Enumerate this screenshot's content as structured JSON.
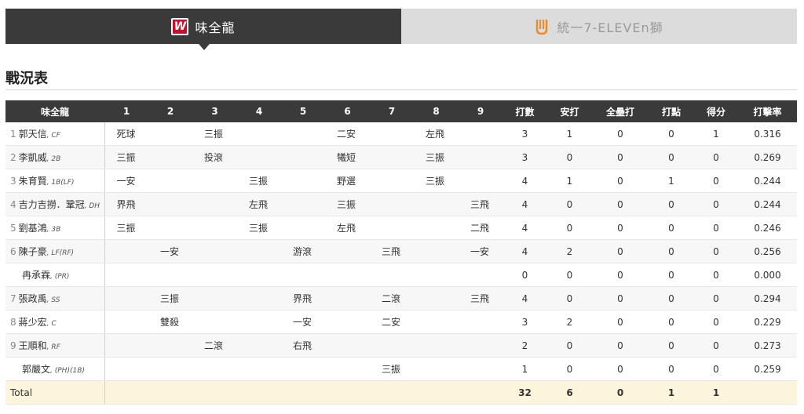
{
  "tabs": [
    {
      "label": "味全龍",
      "icon": "wei-chuan-dragons-logo-icon",
      "active": true
    },
    {
      "label": "統一7-ELEVEn獅",
      "icon": "uni-lions-logo-icon",
      "active": false
    }
  ],
  "section_title": "戰況表",
  "table": {
    "headers": [
      "味全龍",
      "1",
      "2",
      "3",
      "4",
      "5",
      "6",
      "7",
      "8",
      "9",
      "打數",
      "安打",
      "全壘打",
      "打點",
      "得分",
      "打擊率"
    ],
    "rows": [
      {
        "order": "1",
        "name": "郭天信",
        "pos": ", CF",
        "pa": [
          "死球",
          "",
          "三振",
          "",
          "",
          "二安",
          "",
          "左飛",
          ""
        ],
        "stats": [
          "3",
          "1",
          "0",
          "0",
          "1",
          "0.316"
        ]
      },
      {
        "order": "2",
        "name": "李凱威",
        "pos": ", 2B",
        "pa": [
          "三振",
          "",
          "投滾",
          "",
          "",
          "犧短",
          "",
          "三振",
          ""
        ],
        "stats": [
          "3",
          "0",
          "0",
          "0",
          "0",
          "0.269"
        ]
      },
      {
        "order": "3",
        "name": "朱育賢",
        "pos": ", 1B(LF)",
        "pa": [
          "一安",
          "",
          "",
          "三振",
          "",
          "野選",
          "",
          "三振",
          ""
        ],
        "stats": [
          "4",
          "1",
          "0",
          "1",
          "0",
          "0.244"
        ]
      },
      {
        "order": "4",
        "name": "吉力吉撈．鞏冠",
        "pos": ", DH",
        "pa": [
          "界飛",
          "",
          "",
          "左飛",
          "",
          "三振",
          "",
          "",
          "三飛"
        ],
        "stats": [
          "4",
          "0",
          "0",
          "0",
          "0",
          "0.244"
        ]
      },
      {
        "order": "5",
        "name": "劉基鴻",
        "pos": ", 3B",
        "pa": [
          "三振",
          "",
          "",
          "三振",
          "",
          "左飛",
          "",
          "",
          "二飛"
        ],
        "stats": [
          "4",
          "0",
          "0",
          "0",
          "0",
          "0.246"
        ]
      },
      {
        "order": "6",
        "name": "陳子豪",
        "pos": ", LF(RF)",
        "pa": [
          "",
          "一安",
          "",
          "",
          "游滾",
          "",
          "三飛",
          "",
          "一安"
        ],
        "stats": [
          "4",
          "2",
          "0",
          "0",
          "0",
          "0.256"
        ]
      },
      {
        "order": "",
        "name": "冉承霖",
        "pos": ", (PR)",
        "pa": [
          "",
          "",
          "",
          "",
          "",
          "",
          "",
          "",
          ""
        ],
        "stats": [
          "0",
          "0",
          "0",
          "0",
          "0",
          "0.000"
        ]
      },
      {
        "order": "7",
        "name": "張政禹",
        "pos": ", SS",
        "pa": [
          "",
          "三振",
          "",
          "",
          "界飛",
          "",
          "二滾",
          "",
          "三飛"
        ],
        "stats": [
          "4",
          "0",
          "0",
          "0",
          "0",
          "0.294"
        ]
      },
      {
        "order": "8",
        "name": "蔣少宏",
        "pos": ", C",
        "pa": [
          "",
          "雙殺",
          "",
          "",
          "一安",
          "",
          "二安",
          "",
          ""
        ],
        "stats": [
          "3",
          "2",
          "0",
          "0",
          "0",
          "0.229"
        ]
      },
      {
        "order": "9",
        "name": "王順和",
        "pos": ", RF",
        "pa": [
          "",
          "",
          "二滾",
          "",
          "右飛",
          "",
          "",
          "",
          ""
        ],
        "stats": [
          "2",
          "0",
          "0",
          "0",
          "0",
          "0.273"
        ]
      },
      {
        "order": "",
        "name": "郭嚴文",
        "pos": ", (PH)(1B)",
        "pa": [
          "",
          "",
          "",
          "",
          "",
          "",
          "三振",
          "",
          ""
        ],
        "stats": [
          "1",
          "0",
          "0",
          "0",
          "0",
          "0.259"
        ]
      }
    ],
    "total": {
      "label": "Total",
      "stats": [
        "32",
        "6",
        "0",
        "1",
        "1",
        ""
      ]
    }
  },
  "colors": {
    "header_bg": "#3a3a3a",
    "total_bg": "#fdf4dc",
    "wei_chuan_red": "#c8102e",
    "lions_orange": "#f08a24"
  }
}
